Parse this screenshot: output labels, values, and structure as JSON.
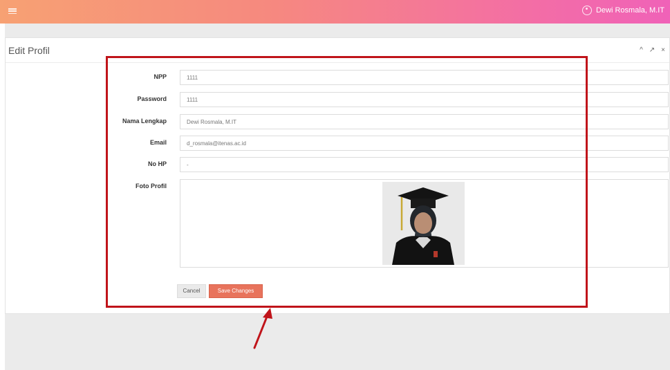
{
  "topbar": {
    "user_name": "Dewi Rosmala, M.IT"
  },
  "panel": {
    "title": "Edit Profil",
    "tool_icons": [
      "^",
      "↗",
      "×"
    ]
  },
  "form": {
    "fields": [
      {
        "label": "NPP",
        "value": "1111"
      },
      {
        "label": "Password",
        "value": "1111"
      },
      {
        "label": "Nama Lengkap",
        "value": "Dewi Rosmala, M.IT"
      },
      {
        "label": "Email",
        "value": "d_rosmala@itenas.ac.id"
      },
      {
        "label": "No HP",
        "value": "-"
      }
    ],
    "photo_label": "Foto Profil",
    "cancel_label": "Cancel",
    "save_label": "Save Changes"
  },
  "colors": {
    "accent": "#e8735c",
    "highlight": "#c0141a"
  }
}
